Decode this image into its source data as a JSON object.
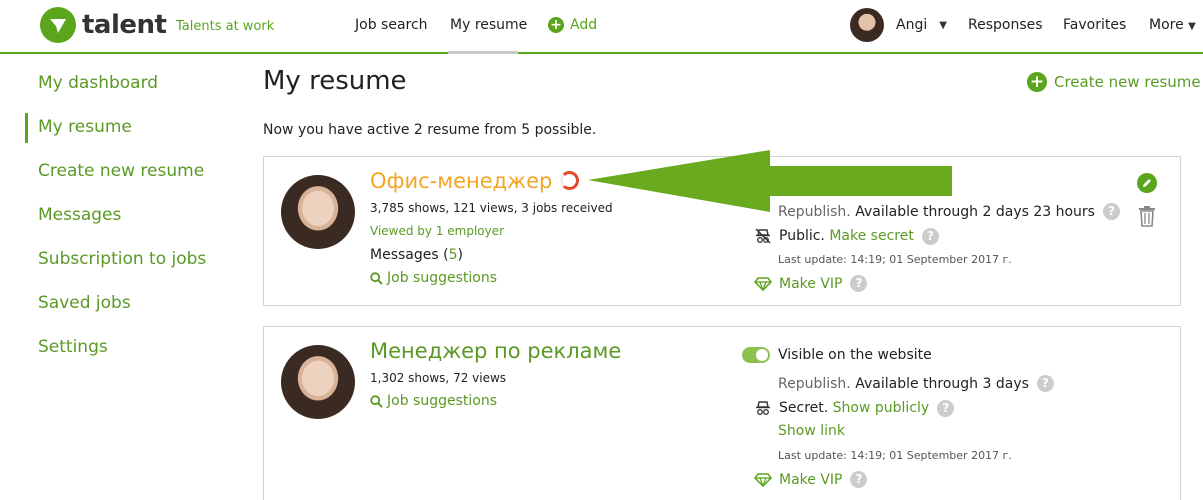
{
  "header": {
    "logo_text": "talent",
    "tagline": "Talents at work",
    "nav": {
      "job_search": "Job search",
      "my_resume": "My resume",
      "add": "Add"
    },
    "user_name": "Angi",
    "responses": "Responses",
    "favorites": "Favorites",
    "more": "More"
  },
  "sidebar": {
    "items": [
      {
        "label": "My dashboard"
      },
      {
        "label": "My resume"
      },
      {
        "label": "Create new resume"
      },
      {
        "label": "Messages"
      },
      {
        "label": "Subscription to jobs"
      },
      {
        "label": "Saved jobs"
      },
      {
        "label": "Settings"
      }
    ],
    "active_index": 1
  },
  "main": {
    "title": "My resume",
    "create_button": "Create new resume",
    "info": "Now you have active 2 resume from 5 possible.",
    "resumes": [
      {
        "title": "Офис-менеджер",
        "stats": "3,785 shows, 121 views, 3 jobs received",
        "viewed": "Viewed by 1 employer",
        "messages_label": "Messages (",
        "messages_count": "5",
        "messages_close": ")",
        "suggestions": "Job suggestions",
        "republish_label": "Republish.",
        "republish_value": "Available through 2 days 23 hours",
        "visibility_label": "Public.",
        "visibility_action": "Make secret",
        "last_update": "Last update: 14:19; 01 September 2017 г.",
        "vip": "Make VIP"
      },
      {
        "title": "Менеджер по рекламе",
        "stats": "1,302 shows, 72 views",
        "suggestions": "Job suggestions",
        "visible_label": "Visible on the website",
        "republish_label": "Republish.",
        "republish_value": "Available through 3 days",
        "visibility_label": "Secret.",
        "visibility_action": "Show publicly",
        "show_link": "Show link",
        "last_update": "Last update: 14:19; 01 September 2017 г.",
        "vip": "Make VIP"
      }
    ]
  },
  "colors": {
    "brand_green": "#5aa51b",
    "title_orange": "#f5a524",
    "arrow_green": "#6aaa1e"
  }
}
